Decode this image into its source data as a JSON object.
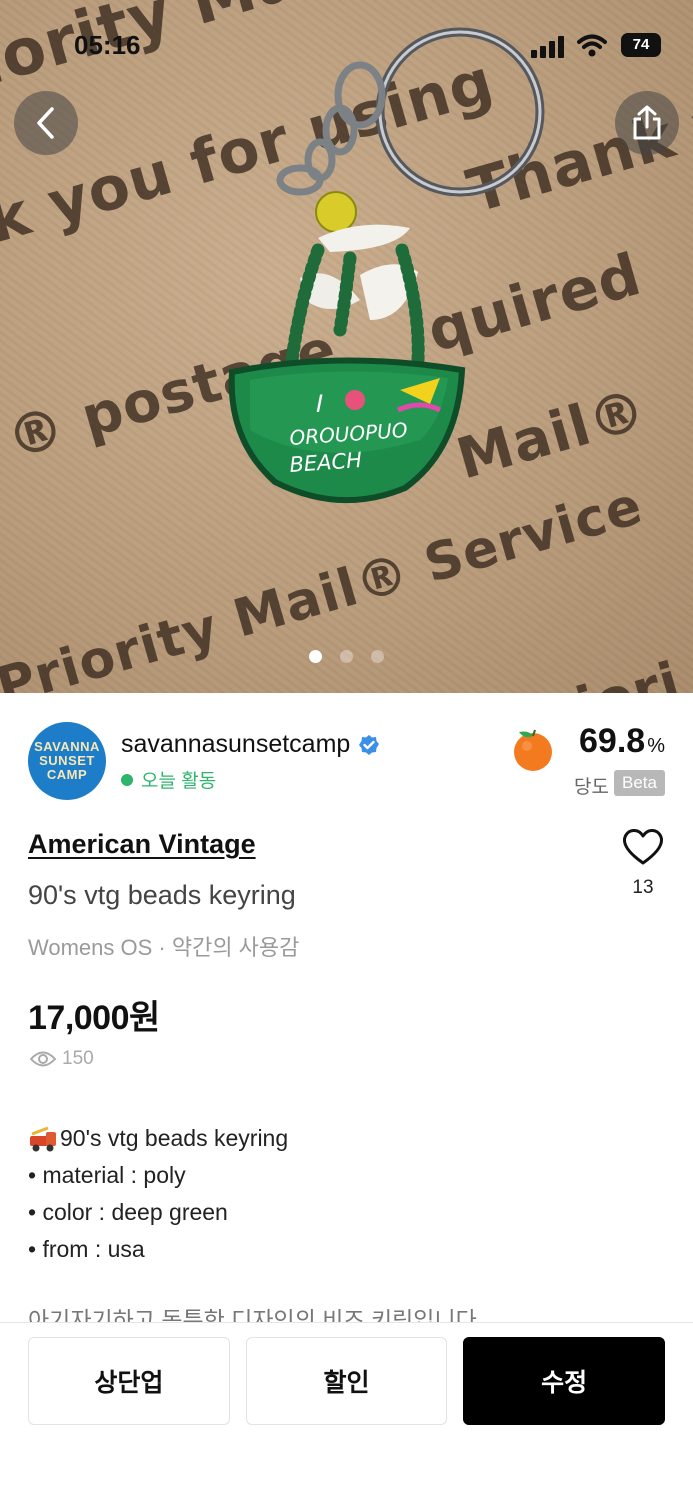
{
  "status_bar": {
    "time": "05:16",
    "battery": "74"
  },
  "photo": {
    "print_text": [
      "iority Mail",
      "k you for using",
      "Thank y",
      "® postage",
      "quired",
      "Mail®",
      "Priority Mail® Service",
      "ing Priori"
    ],
    "keyring_text": [
      "I",
      "OROUOPUO",
      "BEACH"
    ],
    "page_count": 3,
    "active_page": 1
  },
  "seller": {
    "avatar_lines": [
      "SAVANNA",
      "SUNSET",
      "CAMP"
    ],
    "name": "savannasunsetcamp",
    "activity": "오늘 활동",
    "score_value": "69.8",
    "score_unit": "%",
    "score_label": "당도",
    "beta_label": "Beta"
  },
  "product": {
    "brand": "American Vintage",
    "title": "90's vtg beads keyring",
    "meta": "Womens OS · 약간의 사용감",
    "like_count": "13",
    "price": "17,000원",
    "views": "150"
  },
  "description": {
    "lines": [
      "90's vtg beads keyring",
      "• material : poly",
      "• color : deep green",
      "• from : usa"
    ],
    "truncated": "아기자기하고 독특한 디자인의 비즈 키링입니다"
  },
  "actions": {
    "bump": "상단업",
    "discount": "할인",
    "edit": "수정"
  },
  "colors": {
    "accent_green": "#2db56b",
    "verified_blue": "#3b8fe8",
    "fruit_orange": "#f47a1f",
    "primary_button": "#000000"
  }
}
